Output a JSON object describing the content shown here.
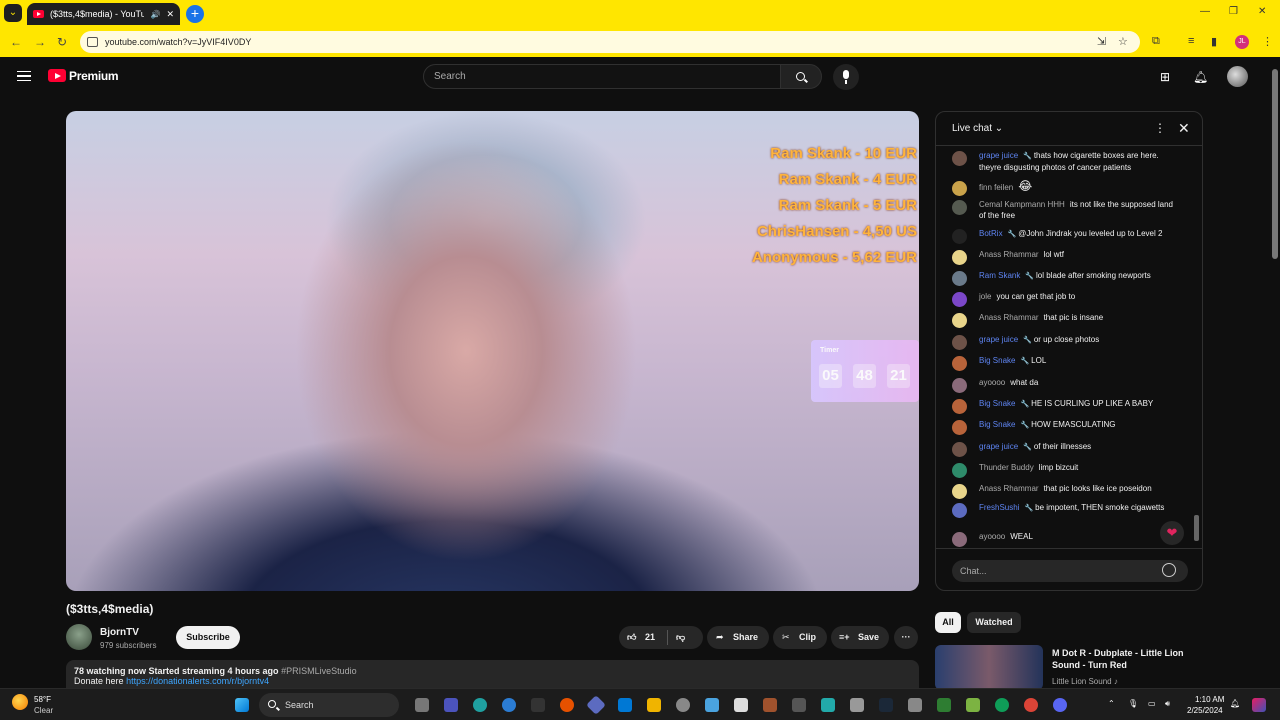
{
  "browser": {
    "tab_title": "($3tts,4$media) - YouTube",
    "url": "youtube.com/watch?v=JyVIF4IV0DY",
    "profile_initials": "JL",
    "accent_color": "#ffe600"
  },
  "header": {
    "logo_text": "Premium",
    "search_placeholder": "Search"
  },
  "video": {
    "donations": [
      "Ram Skank - 10 EUR",
      "Ram Skank - 4 EUR",
      "Ram Skank - 5 EUR",
      "ChrisHansen - 4,50 US",
      "Anonymous - 5,62 EUR"
    ],
    "timer": {
      "label": "Timer",
      "h": "05",
      "m": "48",
      "s": "21"
    },
    "title": "($3tts,4$media)",
    "channel": "BjornTV",
    "subscribers": "979 subscribers",
    "subscribe_label": "Subscribe",
    "likes": "21",
    "share_label": "Share",
    "clip_label": "Clip",
    "save_label": "Save",
    "description": {
      "stats": "78 watching now  Started streaming 4 hours ago",
      "tag": "#PRISMLiveStudio",
      "donate_prefix": "Donate here",
      "donate_link": "https://donationalerts.com/r/bjorntv4"
    }
  },
  "chat": {
    "title": "Live chat",
    "input_placeholder": "Chat...",
    "messages": [
      {
        "author": "grape juice",
        "mod": true,
        "text": "thats how cigarette boxes are here. theyre disgusting photos of cancer patients",
        "avatar": "#6d5248"
      },
      {
        "author": "finn feilen",
        "mod": false,
        "text": "😂",
        "avatar": "#c9a24a"
      },
      {
        "author": "Cemal Kampmann HHH",
        "mod": false,
        "text": "its not like the supposed land of the free",
        "avatar": "#555a50"
      },
      {
        "author": "BotRix",
        "mod": true,
        "text": "@John Jindrak you leveled up to Level 2",
        "avatar": "#222"
      },
      {
        "author": "Anass Rhammar",
        "mod": false,
        "text": "lol wtf",
        "avatar": "#e8d48a"
      },
      {
        "author": "Ram Skank",
        "mod": true,
        "text": "lol blade after smoking newports",
        "avatar": "#6a7a8a"
      },
      {
        "author": "jole",
        "mod": false,
        "text": "you can get that job to",
        "avatar": "#7b47c8"
      },
      {
        "author": "Anass Rhammar",
        "mod": false,
        "text": "that pic is insane",
        "avatar": "#e8d48a"
      },
      {
        "author": "grape juice",
        "mod": true,
        "text": "or up close photos",
        "avatar": "#6d5248"
      },
      {
        "author": "Big Snake",
        "mod": true,
        "text": "LOL",
        "avatar": "#b8633a"
      },
      {
        "author": "ayoooo",
        "mod": false,
        "text": "what da",
        "avatar": "#8a6a7a"
      },
      {
        "author": "Big Snake",
        "mod": true,
        "text": "HE IS CURLING UP LIKE A BABY",
        "avatar": "#b8633a"
      },
      {
        "author": "Big Snake",
        "mod": true,
        "text": "HOW EMASCULATING",
        "avatar": "#b8633a"
      },
      {
        "author": "grape juice",
        "mod": true,
        "text": "of their illnesses",
        "avatar": "#6d5248"
      },
      {
        "author": "Thunder Buddy",
        "mod": false,
        "text": "limp bizcuit",
        "avatar": "#2e8b6a"
      },
      {
        "author": "Anass Rhammar",
        "mod": false,
        "text": "that pic looks like ice poseidon",
        "avatar": "#e8d48a"
      },
      {
        "author": "FreshSushi",
        "mod": true,
        "text": "be impotent, THEN smoke cigawetts",
        "avatar": "#5c6bc0"
      },
      {
        "author": "ayoooo",
        "mod": false,
        "text": "WEAL",
        "avatar": "#8a6a7a"
      }
    ]
  },
  "recommendations": {
    "chips": [
      "All",
      "Watched"
    ],
    "items": [
      {
        "title": "M Dot R - Dubplate - Little Lion Sound - Turn Red",
        "channel": "Little Lion Sound ♪"
      }
    ]
  },
  "taskbar": {
    "weather_temp": "58°F",
    "weather_desc": "Clear",
    "search_label": "Search",
    "time": "1:10 AM",
    "date": "2/25/2024"
  }
}
